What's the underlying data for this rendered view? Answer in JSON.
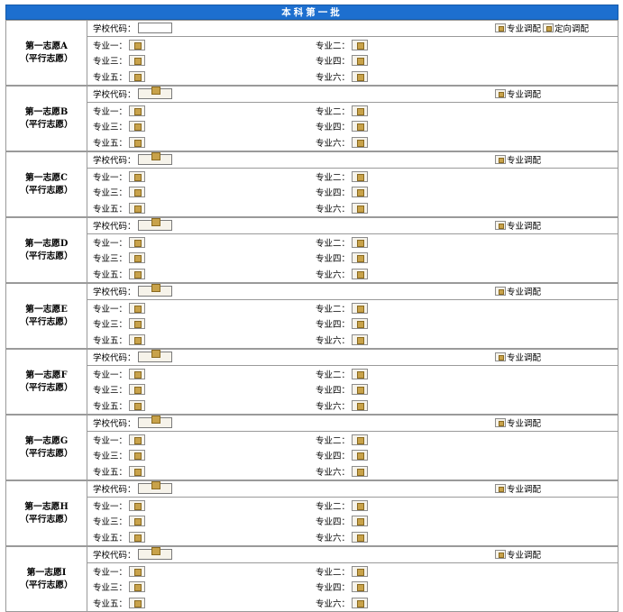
{
  "header": {
    "title": "本科第一批"
  },
  "labels": {
    "school_code": "学校代码：",
    "majors": [
      "专业一：",
      "专业二：",
      "专业三：",
      "专业四：",
      "专业五：",
      "专业六："
    ],
    "major_adjust": "专业调配",
    "directed_adjust": "定向调配"
  },
  "volunteers": [
    {
      "name": "第一志愿A",
      "sub": "（平行志愿）",
      "show_directed": true
    },
    {
      "name": "第一志愿B",
      "sub": "（平行志愿）",
      "show_directed": false
    },
    {
      "name": "第一志愿C",
      "sub": "（平行志愿）",
      "show_directed": false
    },
    {
      "name": "第一志愿D",
      "sub": "（平行志愿）",
      "show_directed": false
    },
    {
      "name": "第一志愿E",
      "sub": "（平行志愿）",
      "show_directed": false
    },
    {
      "name": "第一志愿F",
      "sub": "（平行志愿）",
      "show_directed": false
    },
    {
      "name": "第一志愿G",
      "sub": "（平行志愿）",
      "show_directed": false
    },
    {
      "name": "第一志愿H",
      "sub": "（平行志愿）",
      "show_directed": false
    },
    {
      "name": "第一志愿I",
      "sub": "（平行志愿）",
      "show_directed": false
    }
  ]
}
